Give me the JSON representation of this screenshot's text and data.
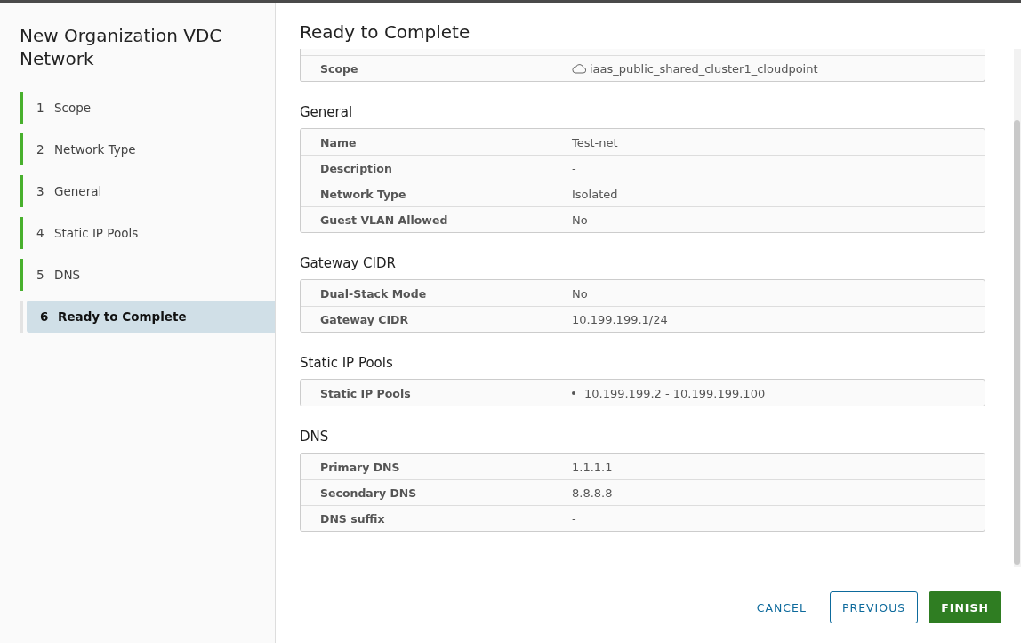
{
  "sidebar": {
    "title": "New Organization VDC Network",
    "steps": [
      {
        "number": "1",
        "label": "Scope",
        "completed": true,
        "selected": false
      },
      {
        "number": "2",
        "label": "Network Type",
        "completed": true,
        "selected": false
      },
      {
        "number": "3",
        "label": "General",
        "completed": true,
        "selected": false
      },
      {
        "number": "4",
        "label": "Static IP Pools",
        "completed": true,
        "selected": false
      },
      {
        "number": "5",
        "label": "DNS",
        "completed": true,
        "selected": false
      },
      {
        "number": "6",
        "label": "Ready to Complete",
        "completed": false,
        "selected": true
      }
    ]
  },
  "main": {
    "title": "Ready to Complete",
    "sections": [
      {
        "rows": [
          {
            "kind": "cloud",
            "label": "Scope",
            "value": "iaas_public_shared_cluster1_cloudpoint"
          }
        ]
      },
      {
        "heading": "General",
        "rows": [
          {
            "kind": "text",
            "label": "Name",
            "value": "Test-net"
          },
          {
            "kind": "text",
            "label": "Description",
            "value": "-"
          },
          {
            "kind": "text",
            "label": "Network Type",
            "value": "Isolated"
          },
          {
            "kind": "text",
            "label": "Guest VLAN Allowed",
            "value": "No"
          }
        ]
      },
      {
        "heading": "Gateway CIDR",
        "rows": [
          {
            "kind": "text",
            "label": "Dual-Stack Mode",
            "value": "No"
          },
          {
            "kind": "text",
            "label": "Gateway CIDR",
            "value": "10.199.199.1/24"
          }
        ]
      },
      {
        "heading": "Static IP Pools",
        "rows": [
          {
            "kind": "list",
            "label": "Static IP Pools",
            "items": [
              "10.199.199.2 - 10.199.199.100"
            ]
          }
        ]
      },
      {
        "heading": "DNS",
        "rows": [
          {
            "kind": "text",
            "label": "Primary DNS",
            "value": "1.1.1.1"
          },
          {
            "kind": "text",
            "label": "Secondary DNS",
            "value": "8.8.8.8"
          },
          {
            "kind": "text",
            "label": "DNS suffix",
            "value": "-"
          }
        ]
      }
    ]
  },
  "buttons": [
    {
      "kind": "flat",
      "label": "CANCEL"
    },
    {
      "kind": "outline",
      "label": "PREVIOUS"
    },
    {
      "kind": "primary",
      "label": "FINISH"
    }
  ]
}
